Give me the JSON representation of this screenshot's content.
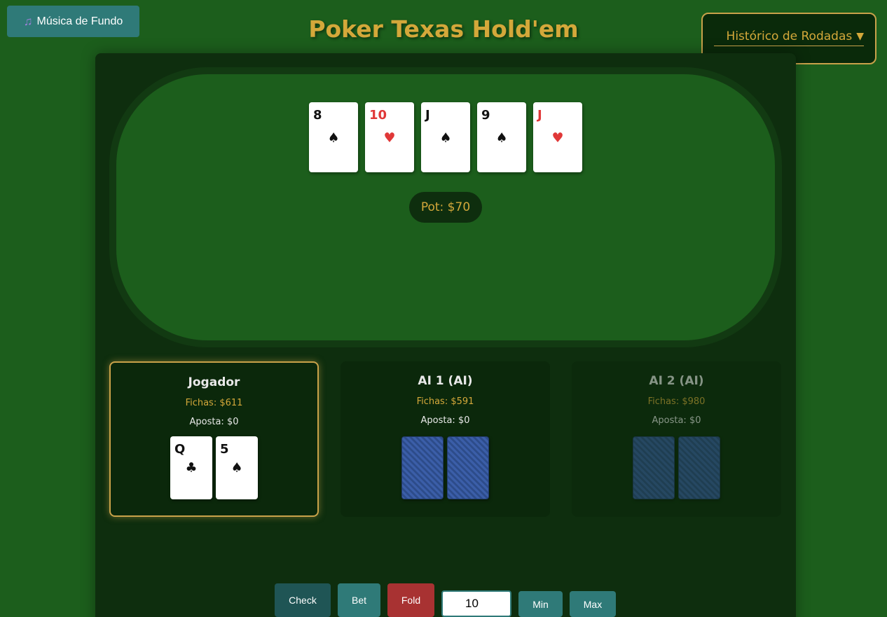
{
  "music": {
    "icon": "♫",
    "label": "Música de Fundo"
  },
  "title": "Poker Texas Hold'em",
  "history": {
    "label": "Histórico de Rodadas",
    "arrow": "▼"
  },
  "community_cards": [
    {
      "rank": "8",
      "suit": "♠",
      "color": "#111111"
    },
    {
      "rank": "10",
      "suit": "♥",
      "color": "#e03838"
    },
    {
      "rank": "J",
      "suit": "♠",
      "color": "#111111"
    },
    {
      "rank": "9",
      "suit": "♠",
      "color": "#111111"
    },
    {
      "rank": "J",
      "suit": "♥",
      "color": "#e03838"
    }
  ],
  "pot": "Pot: $70",
  "players": [
    {
      "name": "Jogador",
      "chips": "Fichas: $611",
      "bet": "Aposta: $0",
      "cards": [
        {
          "rank": "Q",
          "suit": "♣"
        },
        {
          "rank": "5",
          "suit": "♠"
        }
      ]
    },
    {
      "name": "AI 1 (AI)",
      "chips": "Fichas: $591",
      "bet": "Aposta: $0"
    },
    {
      "name": "AI 2 (AI)",
      "chips": "Fichas: $980",
      "bet": "Aposta: $0"
    }
  ],
  "controls": {
    "check": "Check",
    "bet": "Bet",
    "fold": "Fold",
    "amount": "10",
    "min": "Min",
    "max": "Max"
  },
  "colors": {
    "felt": "#1c5e1c",
    "gold": "#d4a83a",
    "teal": "#2f7a78",
    "fold_red": "#a83232"
  }
}
